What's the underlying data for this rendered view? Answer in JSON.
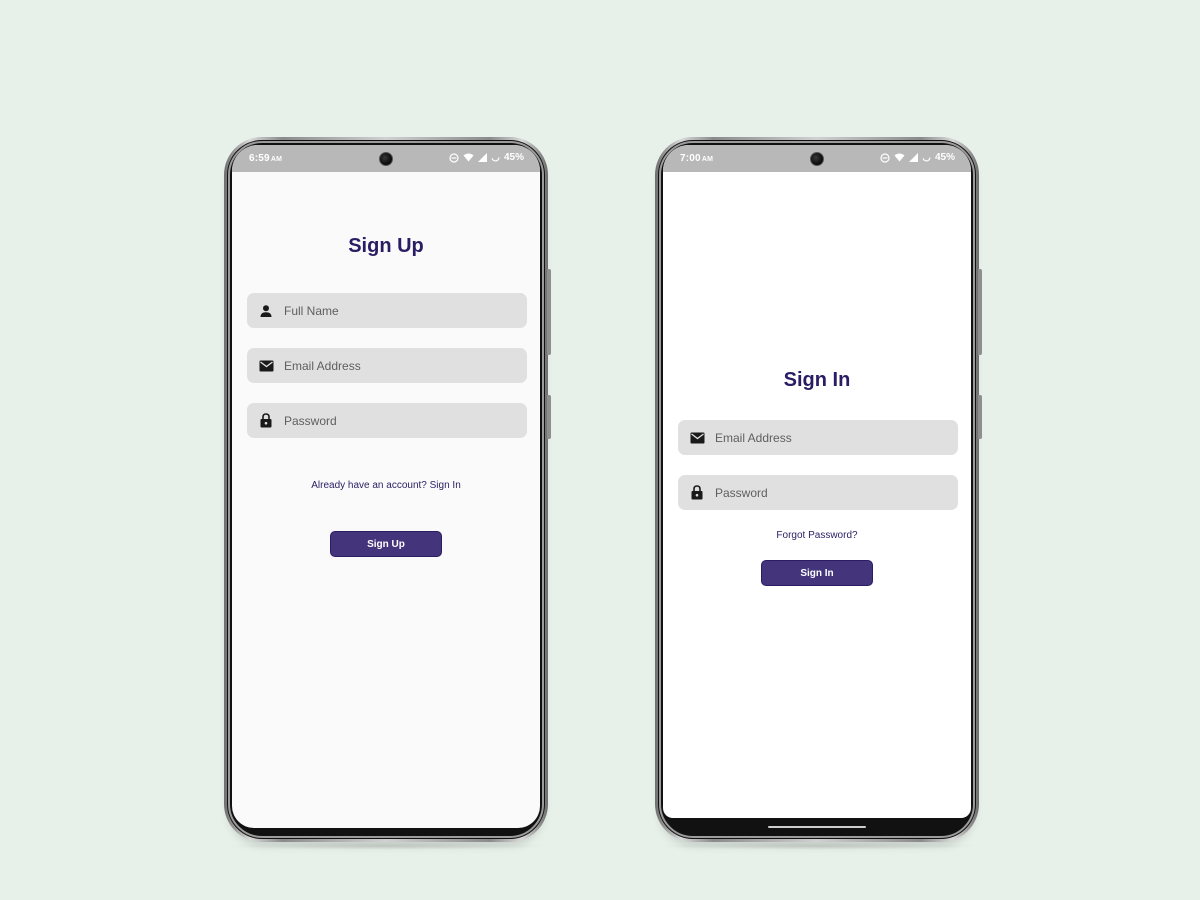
{
  "colors": {
    "background": "#e7f0e9",
    "accent": "#2a1d63",
    "button": "#44347c",
    "field": "#e0e0e0",
    "status_bar": "#b8b8b8"
  },
  "signup_screen": {
    "status": {
      "time": "6:59",
      "ampm": "AM",
      "battery": "45%"
    },
    "title": "Sign Up",
    "fields": [
      {
        "icon": "person-icon",
        "placeholder": "Full Name"
      },
      {
        "icon": "mail-icon",
        "placeholder": "Email Address"
      },
      {
        "icon": "lock-icon",
        "placeholder": "Password"
      }
    ],
    "link": "Already have an account? Sign In",
    "button": "Sign Up"
  },
  "signin_screen": {
    "status": {
      "time": "7:00",
      "ampm": "AM",
      "battery": "45%"
    },
    "title": "Sign In",
    "fields": [
      {
        "icon": "mail-icon",
        "placeholder": "Email Address"
      },
      {
        "icon": "lock-icon",
        "placeholder": "Password"
      }
    ],
    "link": "Forgot Password?",
    "button": "Sign In"
  }
}
